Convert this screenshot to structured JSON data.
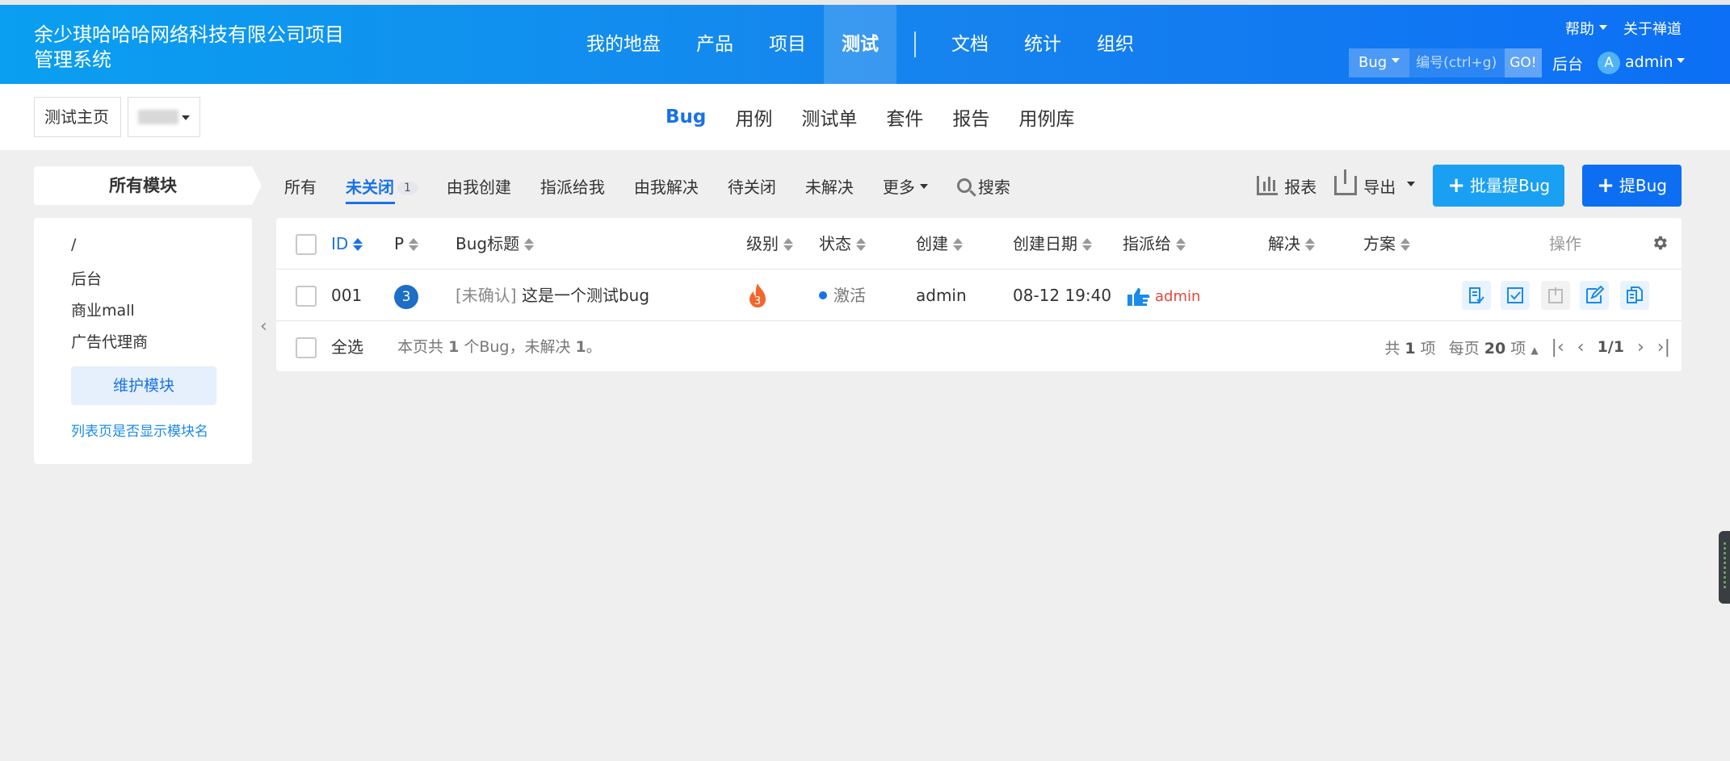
{
  "header": {
    "brand": "余少琪哈哈哈网络科技有限公司项目管理系统",
    "nav": [
      "我的地盘",
      "产品",
      "项目",
      "测试",
      "文档",
      "统计",
      "组织"
    ],
    "help": "帮助",
    "about": "关于禅道",
    "search_type": "Bug",
    "search_placeholder": "编号(ctrl+g)",
    "go": "GO!",
    "backend": "后台",
    "avatar_letter": "A",
    "user": "admin"
  },
  "subheader": {
    "crumb_home": "测试主页",
    "nav": [
      "Bug",
      "用例",
      "测试单",
      "套件",
      "报告",
      "用例库"
    ]
  },
  "modules": {
    "title": "所有模块",
    "items": [
      "/",
      "后台",
      "商业mall",
      "广告代理商"
    ],
    "maintain": "维护模块",
    "show_name": "列表页是否显示模块名"
  },
  "tabs": {
    "all": "所有",
    "unclosed": "未关闭",
    "unclosed_count": "1",
    "created_by_me": "由我创建",
    "assigned_to_me": "指派给我",
    "resolved_by_me": "由我解决",
    "to_close": "待关闭",
    "unresolved": "未解决",
    "more": "更多",
    "search": "搜索"
  },
  "actions": {
    "report": "报表",
    "export": "导出",
    "batch_create": "批量提Bug",
    "create": "提Bug"
  },
  "table": {
    "headers": {
      "id": "ID",
      "pri": "P",
      "title": "Bug标题",
      "severity": "级别",
      "status": "状态",
      "creator": "创建",
      "created_date": "创建日期",
      "assigned_to": "指派给",
      "resolution": "解决",
      "solution": "方案",
      "ops": "操作"
    },
    "rows": [
      {
        "id": "001",
        "pri": "3",
        "tag": "[未确认]",
        "title": "这是一个测试bug",
        "severity": "3",
        "status": "激活",
        "creator": "admin",
        "created_date": "08-12 19:40",
        "assigned_to": "admin"
      }
    ],
    "footer": {
      "select_all": "全选",
      "summary_pre": "本页共",
      "summary_count": "1",
      "summary_mid": "个Bug，未解决",
      "summary_unresolved": "1",
      "summary_end": "。",
      "total_pre": "共",
      "total": "1",
      "total_post": "项",
      "per_page_pre": "每页",
      "per_page": "20",
      "per_page_post": "项",
      "page": "1/1"
    }
  },
  "colors": {
    "primary": "#1872e8",
    "batch_button": "#1aa0f2",
    "create_button": "#0d6ef2",
    "severity_flame": "#f2662e",
    "assign_red": "#e0483b"
  }
}
